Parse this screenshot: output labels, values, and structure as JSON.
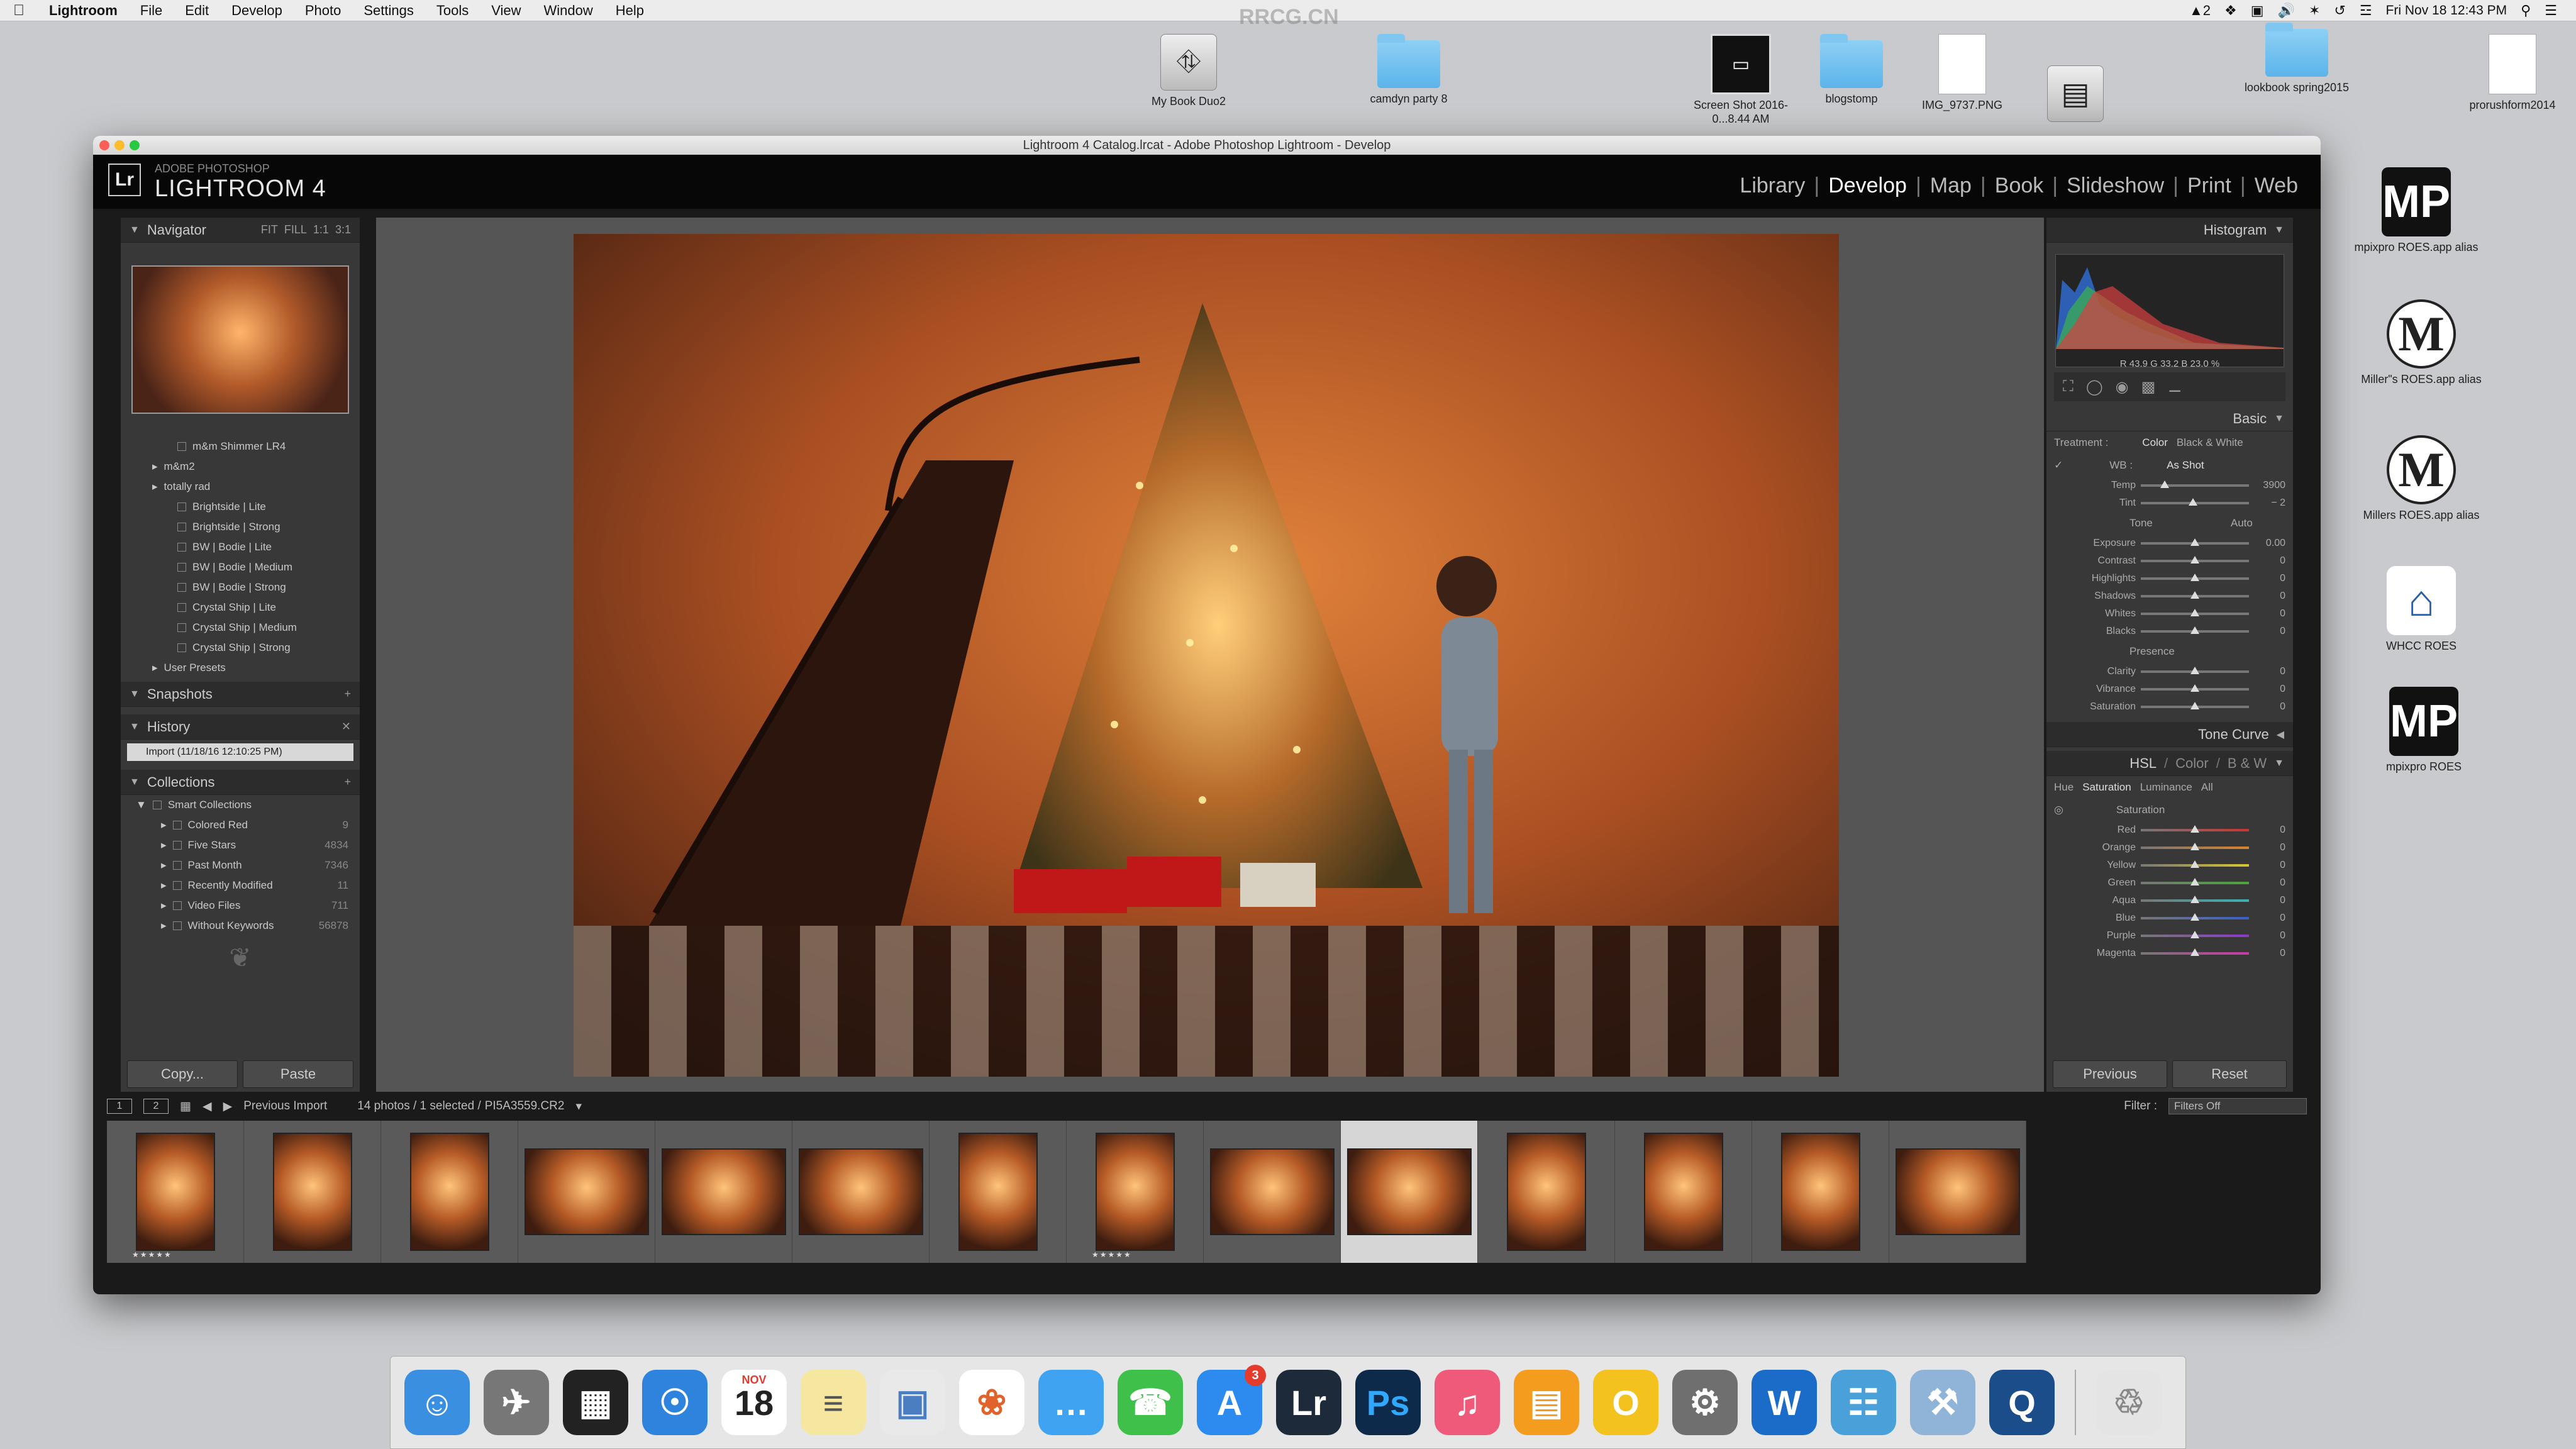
{
  "menubar": {
    "app": "Lightroom",
    "items": [
      "File",
      "Edit",
      "Develop",
      "Photo",
      "Settings",
      "Tools",
      "View",
      "Window",
      "Help"
    ],
    "status_input": "2",
    "datetime": "Fri Nov 18  12:43 PM"
  },
  "watermark": "RRCG.CN",
  "desktop": {
    "icons": [
      {
        "label": "My Book Duo2",
        "icon": "usb-drive-icon"
      },
      {
        "label": "camdyn party 8",
        "icon": "folder-icon"
      },
      {
        "label": "Screen Shot 2016-0...8.44 AM",
        "icon": "screenshot-file-icon"
      },
      {
        "label": "blogstomp",
        "icon": "folder-icon"
      },
      {
        "label": "IMG_9737.PNG",
        "icon": "png-file-icon"
      },
      {
        "label": "",
        "icon": "hard-drive-icon"
      },
      {
        "label": "lookbook spring2015",
        "icon": "folder-icon"
      },
      {
        "label": "prorushform2014",
        "icon": "document-icon"
      },
      {
        "label": "mpixpro ROES.app alias",
        "icon": "mpixpro-app-icon"
      },
      {
        "label": "Miller\"s ROES.app alias",
        "icon": "millers-app-icon"
      },
      {
        "label": "Millers ROES.app alias",
        "icon": "millers-app-icon"
      },
      {
        "label": "WHCC ROES",
        "icon": "whcc-app-icon"
      },
      {
        "label": "mpixpro ROES",
        "icon": "mpixpro-app-icon"
      }
    ]
  },
  "window": {
    "title": "Lightroom 4 Catalog.lrcat - Adobe Photoshop Lightroom - Develop",
    "brand_small": "ADOBE PHOTOSHOP",
    "brand_big": "LIGHTROOM 4",
    "logo": "Lr",
    "modules": [
      "Library",
      "Develop",
      "Map",
      "Book",
      "Slideshow",
      "Print",
      "Web"
    ],
    "active_module": "Develop"
  },
  "left": {
    "navigator": {
      "title": "Navigator",
      "zoom": [
        "FIT",
        "FILL",
        "1:1",
        "3:1"
      ]
    },
    "presets": [
      {
        "label": "m&m Shimmer LR4",
        "level": 2
      },
      {
        "label": "m&m2",
        "level": 1
      },
      {
        "label": "totally rad",
        "level": 1
      },
      {
        "label": "Brightside | Lite",
        "level": 2
      },
      {
        "label": "Brightside | Strong",
        "level": 2
      },
      {
        "label": "BW | Bodie | Lite",
        "level": 2
      },
      {
        "label": "BW | Bodie | Medium",
        "level": 2
      },
      {
        "label": "BW | Bodie | Strong",
        "level": 2
      },
      {
        "label": "Crystal Ship | Lite",
        "level": 2
      },
      {
        "label": "Crystal Ship | Medium",
        "level": 2
      },
      {
        "label": "Crystal Ship | Strong",
        "level": 2
      },
      {
        "label": "User Presets",
        "level": 1
      }
    ],
    "snapshots": "Snapshots",
    "history": "History",
    "history_item": "Import (11/18/16 12:10:25 PM)",
    "collections": "Collections",
    "smart_collections": "Smart Collections",
    "collection_items": [
      {
        "label": "Colored Red",
        "count": "9"
      },
      {
        "label": "Five Stars",
        "count": "4834"
      },
      {
        "label": "Past Month",
        "count": "7346"
      },
      {
        "label": "Recently Modified",
        "count": "11"
      },
      {
        "label": "Video Files",
        "count": "711"
      },
      {
        "label": "Without Keywords",
        "count": "56878"
      }
    ],
    "copy": "Copy...",
    "paste": "Paste"
  },
  "right": {
    "histogram": "Histogram",
    "rgb_readout": "R  43.9   G  33.2   B  23.0 %",
    "basic": "Basic",
    "treatment_label": "Treatment :",
    "treatment_color": "Color",
    "treatment_bw": "Black & White",
    "wb_label": "WB :",
    "wb_value": "As Shot",
    "temp": {
      "label": "Temp",
      "value": "3900",
      "pos": 0.22
    },
    "tint": {
      "label": "Tint",
      "value": "− 2",
      "pos": 0.48
    },
    "tone": "Tone",
    "auto": "Auto",
    "tone_sliders": [
      {
        "label": "Exposure",
        "value": "0.00",
        "pos": 0.5
      },
      {
        "label": "Contrast",
        "value": "0",
        "pos": 0.5
      },
      {
        "label": "Highlights",
        "value": "0",
        "pos": 0.5
      },
      {
        "label": "Shadows",
        "value": "0",
        "pos": 0.5
      },
      {
        "label": "Whites",
        "value": "0",
        "pos": 0.5
      },
      {
        "label": "Blacks",
        "value": "0",
        "pos": 0.5
      }
    ],
    "presence": "Presence",
    "presence_sliders": [
      {
        "label": "Clarity",
        "value": "0",
        "pos": 0.5
      },
      {
        "label": "Vibrance",
        "value": "0",
        "pos": 0.5
      },
      {
        "label": "Saturation",
        "value": "0",
        "pos": 0.5
      }
    ],
    "tone_curve": "Tone Curve",
    "hsl_tabs": [
      "HSL",
      "Color",
      "B & W"
    ],
    "hsl_subtabs": [
      "Hue",
      "Saturation",
      "Luminance",
      "All"
    ],
    "saturation": "Saturation",
    "sat_sliders": [
      {
        "label": "Red",
        "value": "0",
        "pos": 0.5,
        "color": "#c33"
      },
      {
        "label": "Orange",
        "value": "0",
        "pos": 0.5,
        "color": "#d8822c"
      },
      {
        "label": "Yellow",
        "value": "0",
        "pos": 0.5,
        "color": "#d8c82c"
      },
      {
        "label": "Green",
        "value": "0",
        "pos": 0.5,
        "color": "#4aa63a"
      },
      {
        "label": "Aqua",
        "value": "0",
        "pos": 0.5,
        "color": "#3ab2b2"
      },
      {
        "label": "Blue",
        "value": "0",
        "pos": 0.5,
        "color": "#3a5fc8"
      },
      {
        "label": "Purple",
        "value": "0",
        "pos": 0.5,
        "color": "#8a3ac8"
      },
      {
        "label": "Magenta",
        "value": "0",
        "pos": 0.5,
        "color": "#c83aa6"
      }
    ],
    "previous": "Previous",
    "reset": "Reset"
  },
  "filmbar": {
    "page1": "1",
    "page2": "2",
    "source": "Previous Import",
    "count": "14 photos / 1 selected /",
    "filename": "PI5A3559.CR2",
    "filter_label": "Filter :",
    "filter_value": "Filters Off"
  },
  "filmstrip": [
    {
      "orient": "p",
      "stars": "★★★★★",
      "selected": false
    },
    {
      "orient": "p",
      "stars": "",
      "selected": false
    },
    {
      "orient": "p",
      "stars": "",
      "selected": false
    },
    {
      "orient": "l",
      "stars": "",
      "selected": false
    },
    {
      "orient": "l",
      "stars": "",
      "selected": false
    },
    {
      "orient": "l",
      "stars": "",
      "selected": false
    },
    {
      "orient": "p",
      "stars": "",
      "selected": false
    },
    {
      "orient": "p",
      "stars": "★★★★★",
      "selected": false
    },
    {
      "orient": "l",
      "stars": "",
      "selected": false
    },
    {
      "orient": "l",
      "stars": "",
      "selected": true
    },
    {
      "orient": "p",
      "stars": "",
      "selected": false
    },
    {
      "orient": "p",
      "stars": "",
      "selected": false
    },
    {
      "orient": "p",
      "stars": "",
      "selected": false
    },
    {
      "orient": "l",
      "stars": "",
      "selected": false
    }
  ],
  "dock": {
    "apps": [
      {
        "name": "finder-icon",
        "glyph": "☺",
        "color": "#3b8fe0"
      },
      {
        "name": "launchpad-icon",
        "glyph": "✈",
        "color": "#777"
      },
      {
        "name": "photo-browser-icon",
        "glyph": "▦",
        "color": "#222"
      },
      {
        "name": "safari-icon",
        "glyph": "☉",
        "color": "#2e84dc"
      },
      {
        "name": "calendar-icon",
        "glyph": "18",
        "color": "#fff",
        "text": "#222",
        "top": "NOV"
      },
      {
        "name": "notes-icon",
        "glyph": "≡",
        "color": "#f6e7a0",
        "text": "#555"
      },
      {
        "name": "preview-icon",
        "glyph": "▣",
        "color": "#e9e9e9",
        "text": "#4a7ec0"
      },
      {
        "name": "photos-icon",
        "glyph": "❀",
        "color": "#fff",
        "text": "#e0632c"
      },
      {
        "name": "messages-icon",
        "glyph": "…",
        "color": "#3fa3f1"
      },
      {
        "name": "facetime-icon",
        "glyph": "☎",
        "color": "#3ec04b"
      },
      {
        "name": "app-store-icon",
        "glyph": "A",
        "color": "#2d8bf0",
        "badge": "3"
      },
      {
        "name": "lightroom-icon",
        "glyph": "Lr",
        "color": "#1d2a3a"
      },
      {
        "name": "photoshop-icon",
        "glyph": "Ps",
        "color": "#0e2a4a",
        "text": "#31a8ff"
      },
      {
        "name": "itunes-icon",
        "glyph": "♫",
        "color": "#f05a7a"
      },
      {
        "name": "ibooks-icon",
        "glyph": "▤",
        "color": "#f39c1e"
      },
      {
        "name": "opera-icon",
        "glyph": "O",
        "color": "#f3c21e"
      },
      {
        "name": "system-preferences-icon",
        "glyph": "⚙",
        "color": "#6f6f6f"
      },
      {
        "name": "word-icon",
        "glyph": "W",
        "color": "#1a6cc8"
      },
      {
        "name": "network-icon",
        "glyph": "☷",
        "color": "#4aa0d8"
      },
      {
        "name": "utility-icon",
        "glyph": "⚒",
        "color": "#8fb4d8"
      },
      {
        "name": "quicktime-icon",
        "glyph": "Q",
        "color": "#1a4d8a"
      },
      {
        "name": "trash-icon",
        "glyph": "♲",
        "color": "#e4e4e4",
        "text": "#888"
      }
    ]
  }
}
